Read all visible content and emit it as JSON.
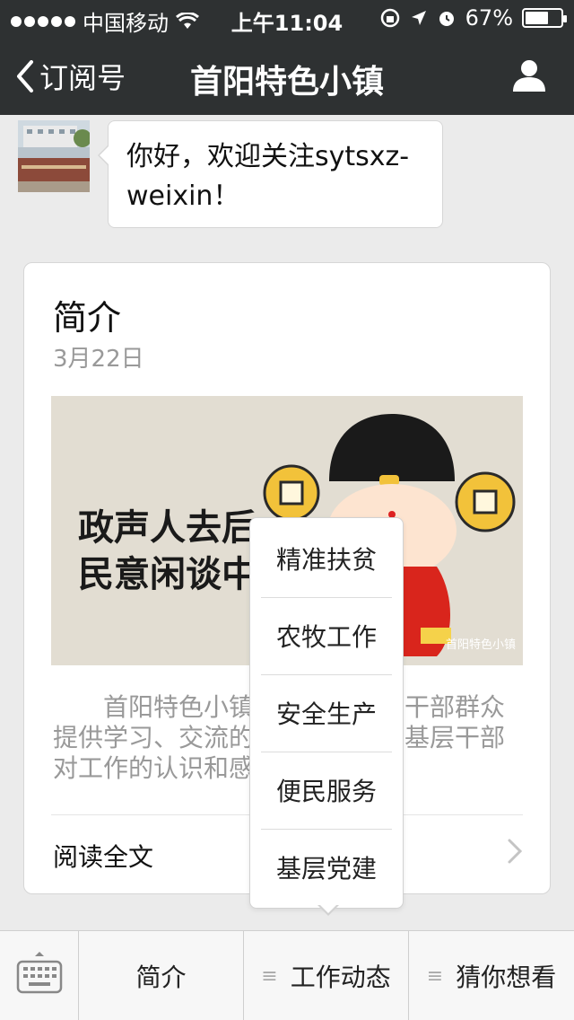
{
  "status_bar": {
    "carrier": "中国移动",
    "time": "上午11:04",
    "battery_percent": "67%",
    "battery_level": 0.67,
    "icons": [
      "signal-dots-icon",
      "wifi-icon",
      "rotation-lock-icon",
      "location-icon",
      "alarm-icon",
      "battery-icon"
    ]
  },
  "nav": {
    "back_label": "订阅号",
    "title": "首阳特色小镇",
    "icons": [
      "back-chevron-icon",
      "person-icon"
    ]
  },
  "chat": {
    "message": "你好，欢迎关注sytsxz-weixin！"
  },
  "article": {
    "title": "简介",
    "date": "3月22日",
    "image_text_line1": "政声人去后",
    "image_text_line2": "民意闲谈中",
    "image_watermark": "首阳特色小镇",
    "description": "首阳特色小镇公众号为广大干部群众提供学习、交流的平台，能看到基层干部对工作的认识和感想，也能",
    "read_more": "阅读全文"
  },
  "popup_menu": {
    "items": [
      "精准扶贫",
      "农牧工作",
      "安全生产",
      "便民服务",
      "基层党建"
    ]
  },
  "bottom_menu": {
    "items": [
      "简介",
      "工作动态",
      "猜你想看"
    ],
    "icons": [
      "keyboard-icon",
      "menu-lines-icon"
    ]
  },
  "colors": {
    "header_bg": "#2e3132",
    "page_bg": "#ebebeb",
    "card_bg": "#ffffff",
    "muted_text": "#999999"
  }
}
